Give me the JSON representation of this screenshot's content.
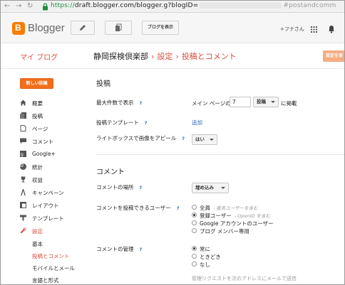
{
  "browser": {
    "url_scheme": "https://",
    "url_main": "draft.blogger.com/blogger.g?blogID=",
    "url_tail": "#postandcomm"
  },
  "header": {
    "brand": "Blogger",
    "view_blog_label": "ブログを表示",
    "user_label": "+フナさん"
  },
  "title_bar": {
    "my_blog": "マイ ブログ",
    "blog_name": "静岡探検倶楽部",
    "sep1": "›",
    "crumb1": "設定",
    "sep2": "›",
    "crumb2": "投稿とコメント",
    "save_label": "設定を保"
  },
  "sidebar": {
    "new_post": "新しい投稿",
    "items": [
      {
        "label": "概要",
        "icon": "home-icon"
      },
      {
        "label": "投稿",
        "icon": "posts-icon"
      },
      {
        "label": "ページ",
        "icon": "page-icon"
      },
      {
        "label": "コメント",
        "icon": "comment-icon"
      },
      {
        "label": "Google+",
        "icon": "google-plus-icon"
      },
      {
        "label": "統計",
        "icon": "stats-icon"
      },
      {
        "label": "収益",
        "icon": "trophy-icon"
      },
      {
        "label": "キャンペーン",
        "icon": "adwords-icon"
      },
      {
        "label": "レイアウト",
        "icon": "layout-icon"
      },
      {
        "label": "テンプレート",
        "icon": "template-icon"
      },
      {
        "label": "設定",
        "icon": "wrench-icon"
      }
    ],
    "sub_items": [
      "基本",
      "投稿とコメント",
      "モバイルとメール",
      "言語と形式"
    ]
  },
  "posts": {
    "title": "投稿",
    "max_label": "最大件数で表示",
    "max_prefix": "メイン ページの",
    "max_value": "7",
    "max_unit": "投稿",
    "max_suffix": "に掲載",
    "template_label": "投稿テンプレート",
    "template_action": "追加",
    "lightbox_label": "ライトボックスで画像をアピール",
    "lightbox_value": "はい"
  },
  "comments": {
    "title": "コメント",
    "location_label": "コメントの場所",
    "location_value": "埋め込み",
    "who_label": "コメントを投稿できるユーザー",
    "who_options": [
      {
        "label": "全員",
        "note": "- 匿名ユーザーを含む",
        "selected": false
      },
      {
        "label": "登録ユーザー",
        "note": "- OpenID を含む",
        "selected": true
      },
      {
        "label": "Google アカウントのユーザー",
        "note": "",
        "selected": false
      },
      {
        "label": "ブログ メンバー専用",
        "note": "",
        "selected": false
      }
    ],
    "moderation_label": "コメントの管理",
    "moderation_options": [
      {
        "label": "常に",
        "selected": true
      },
      {
        "label": "ときどき",
        "selected": false
      },
      {
        "label": "なし",
        "selected": false
      }
    ],
    "moderation_note": "管理リクエストを次のアドレスにメールで送信"
  },
  "help_glyph": "?"
}
